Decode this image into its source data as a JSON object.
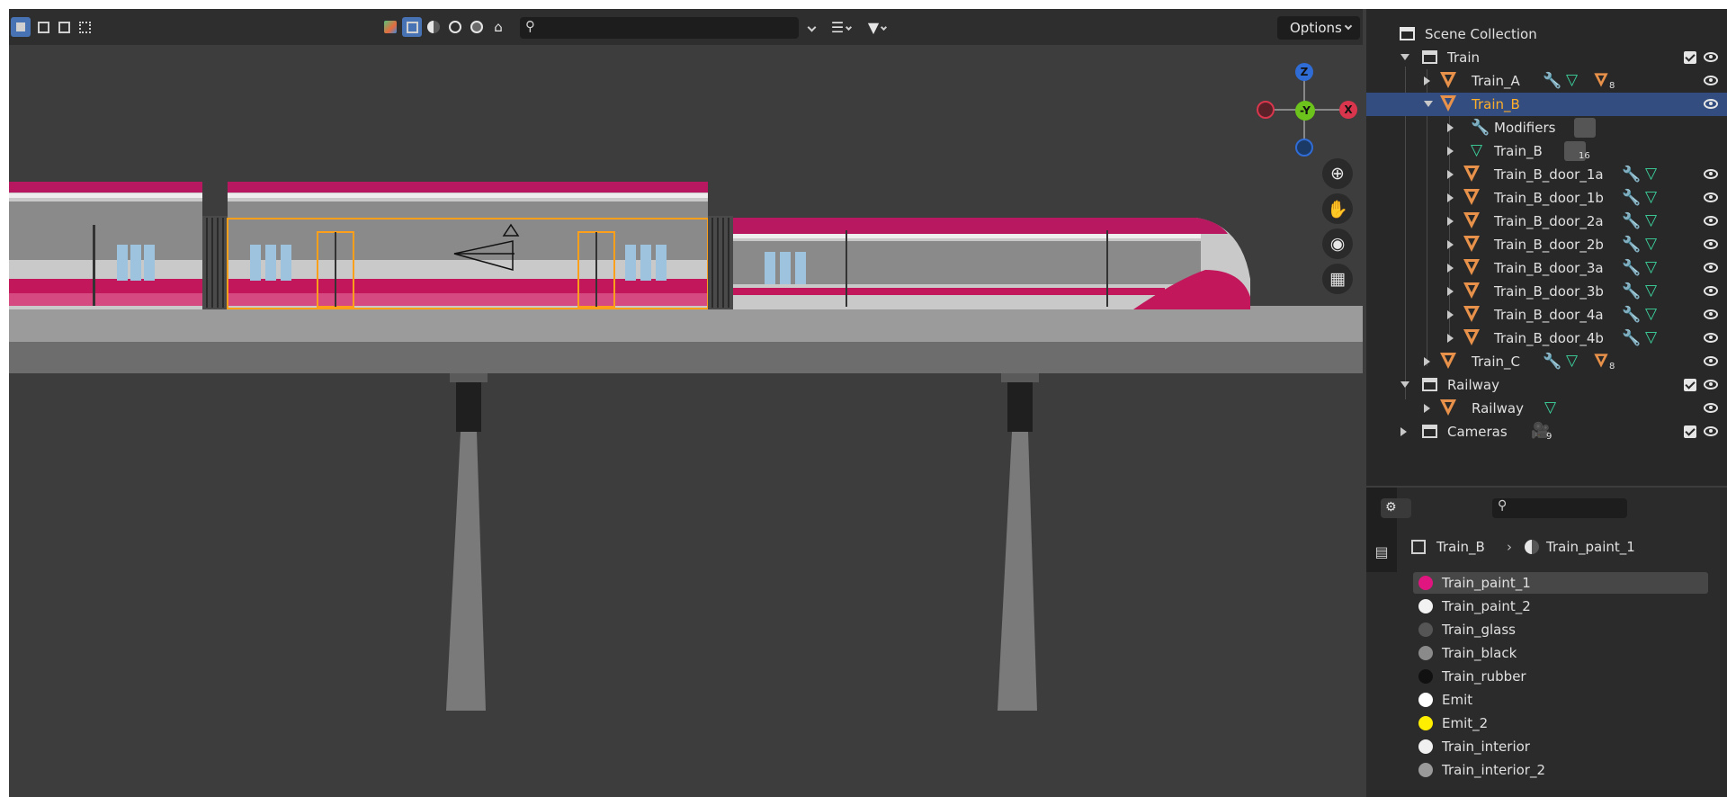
{
  "viewport": {
    "header": {
      "options_label": "Options",
      "search_placeholder": ""
    },
    "gizmo": {
      "z": "Z",
      "y": "-Y",
      "x": "X"
    },
    "colors": {
      "train_paint": "#c2185b",
      "bridge": "#9b9b9b",
      "selection": "#ff9f1a"
    }
  },
  "outliner": {
    "root": "Scene Collection",
    "collections": [
      {
        "name": "Train",
        "children": [
          {
            "name": "Train_A",
            "badge": "8"
          },
          {
            "name": "Train_B",
            "selected": true,
            "children": [
              {
                "name": "Modifiers"
              },
              {
                "name": "Train_B",
                "badge": "16"
              },
              {
                "name": "Train_B_door_1a"
              },
              {
                "name": "Train_B_door_1b"
              },
              {
                "name": "Train_B_door_2a"
              },
              {
                "name": "Train_B_door_2b"
              },
              {
                "name": "Train_B_door_3a"
              },
              {
                "name": "Train_B_door_3b"
              },
              {
                "name": "Train_B_door_4a"
              },
              {
                "name": "Train_B_door_4b"
              }
            ]
          },
          {
            "name": "Train_C",
            "badge": "8"
          }
        ]
      },
      {
        "name": "Railway",
        "children": [
          {
            "name": "Railway"
          }
        ]
      },
      {
        "name": "Cameras",
        "badge": "9"
      }
    ]
  },
  "properties": {
    "search_placeholder": "",
    "breadcrumb": {
      "object": "Train_B",
      "material": "Train_paint_1"
    },
    "materials": [
      {
        "name": "Train_paint_1",
        "color": "#e0157f",
        "active": true
      },
      {
        "name": "Train_paint_2",
        "color": "#f2f2f2"
      },
      {
        "name": "Train_glass",
        "color": "#555555"
      },
      {
        "name": "Train_black",
        "color": "#8a8a8a"
      },
      {
        "name": "Train_rubber",
        "color": "#111111"
      },
      {
        "name": "Emit",
        "color": "#ffffff"
      },
      {
        "name": "Emit_2",
        "color": "#ffee00"
      },
      {
        "name": "Train_interior",
        "color": "#f0f0f0"
      },
      {
        "name": "Train_interior_2",
        "color": "#9a9a9a"
      }
    ]
  }
}
